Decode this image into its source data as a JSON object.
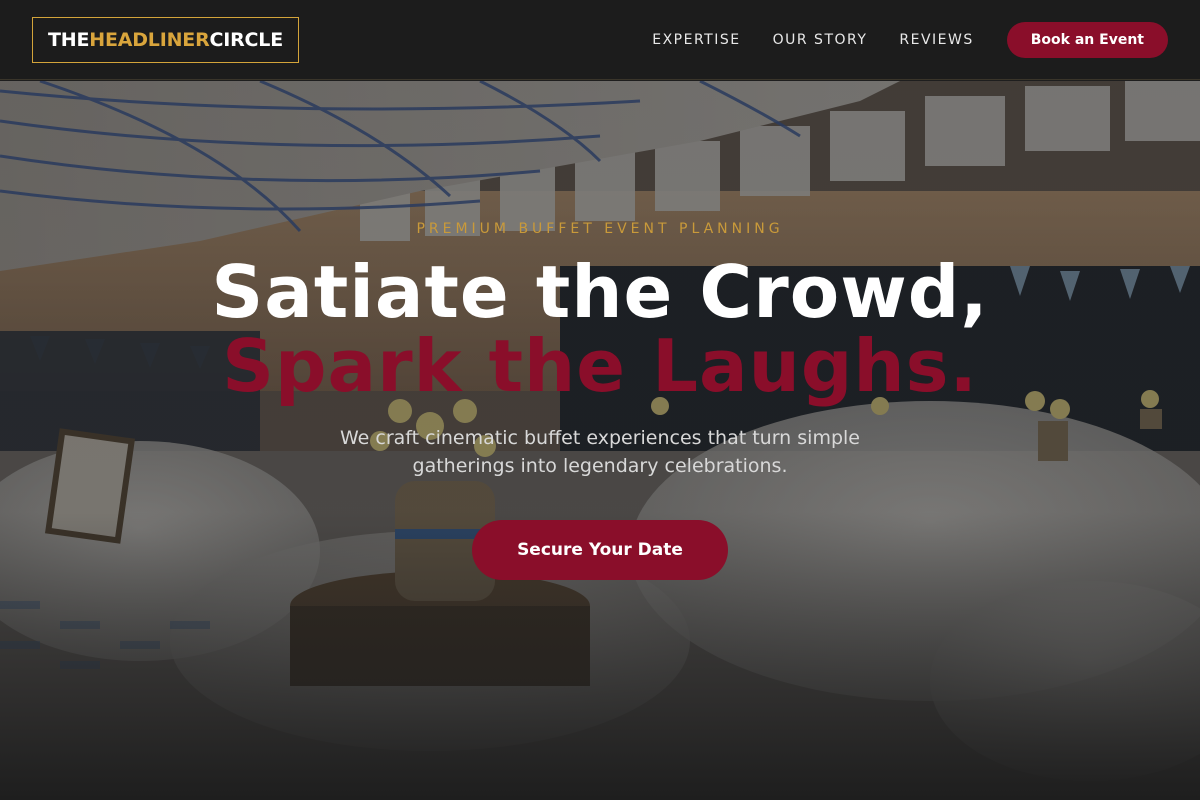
{
  "header": {
    "logo": {
      "part1": "THE ",
      "part2": "HEADLINER",
      "part3": " CIRCLE"
    },
    "nav": [
      {
        "label": "EXPERTISE"
      },
      {
        "label": "OUR STORY"
      },
      {
        "label": "REVIEWS"
      }
    ],
    "cta_label": "Book an Event"
  },
  "hero": {
    "eyebrow": "PREMIUM BUFFET EVENT PLANNING",
    "headline_line1": "Satiate the Crowd,",
    "headline_line2": "Spark the Laughs.",
    "subtitle": "We craft cinematic buffet experiences that turn simple gatherings into legendary celebrations.",
    "cta_label": "Secure Your Date"
  },
  "colors": {
    "accent_gold": "#d9a53c",
    "accent_crimson": "#8a0e2a",
    "background": "#1e1e1e"
  }
}
